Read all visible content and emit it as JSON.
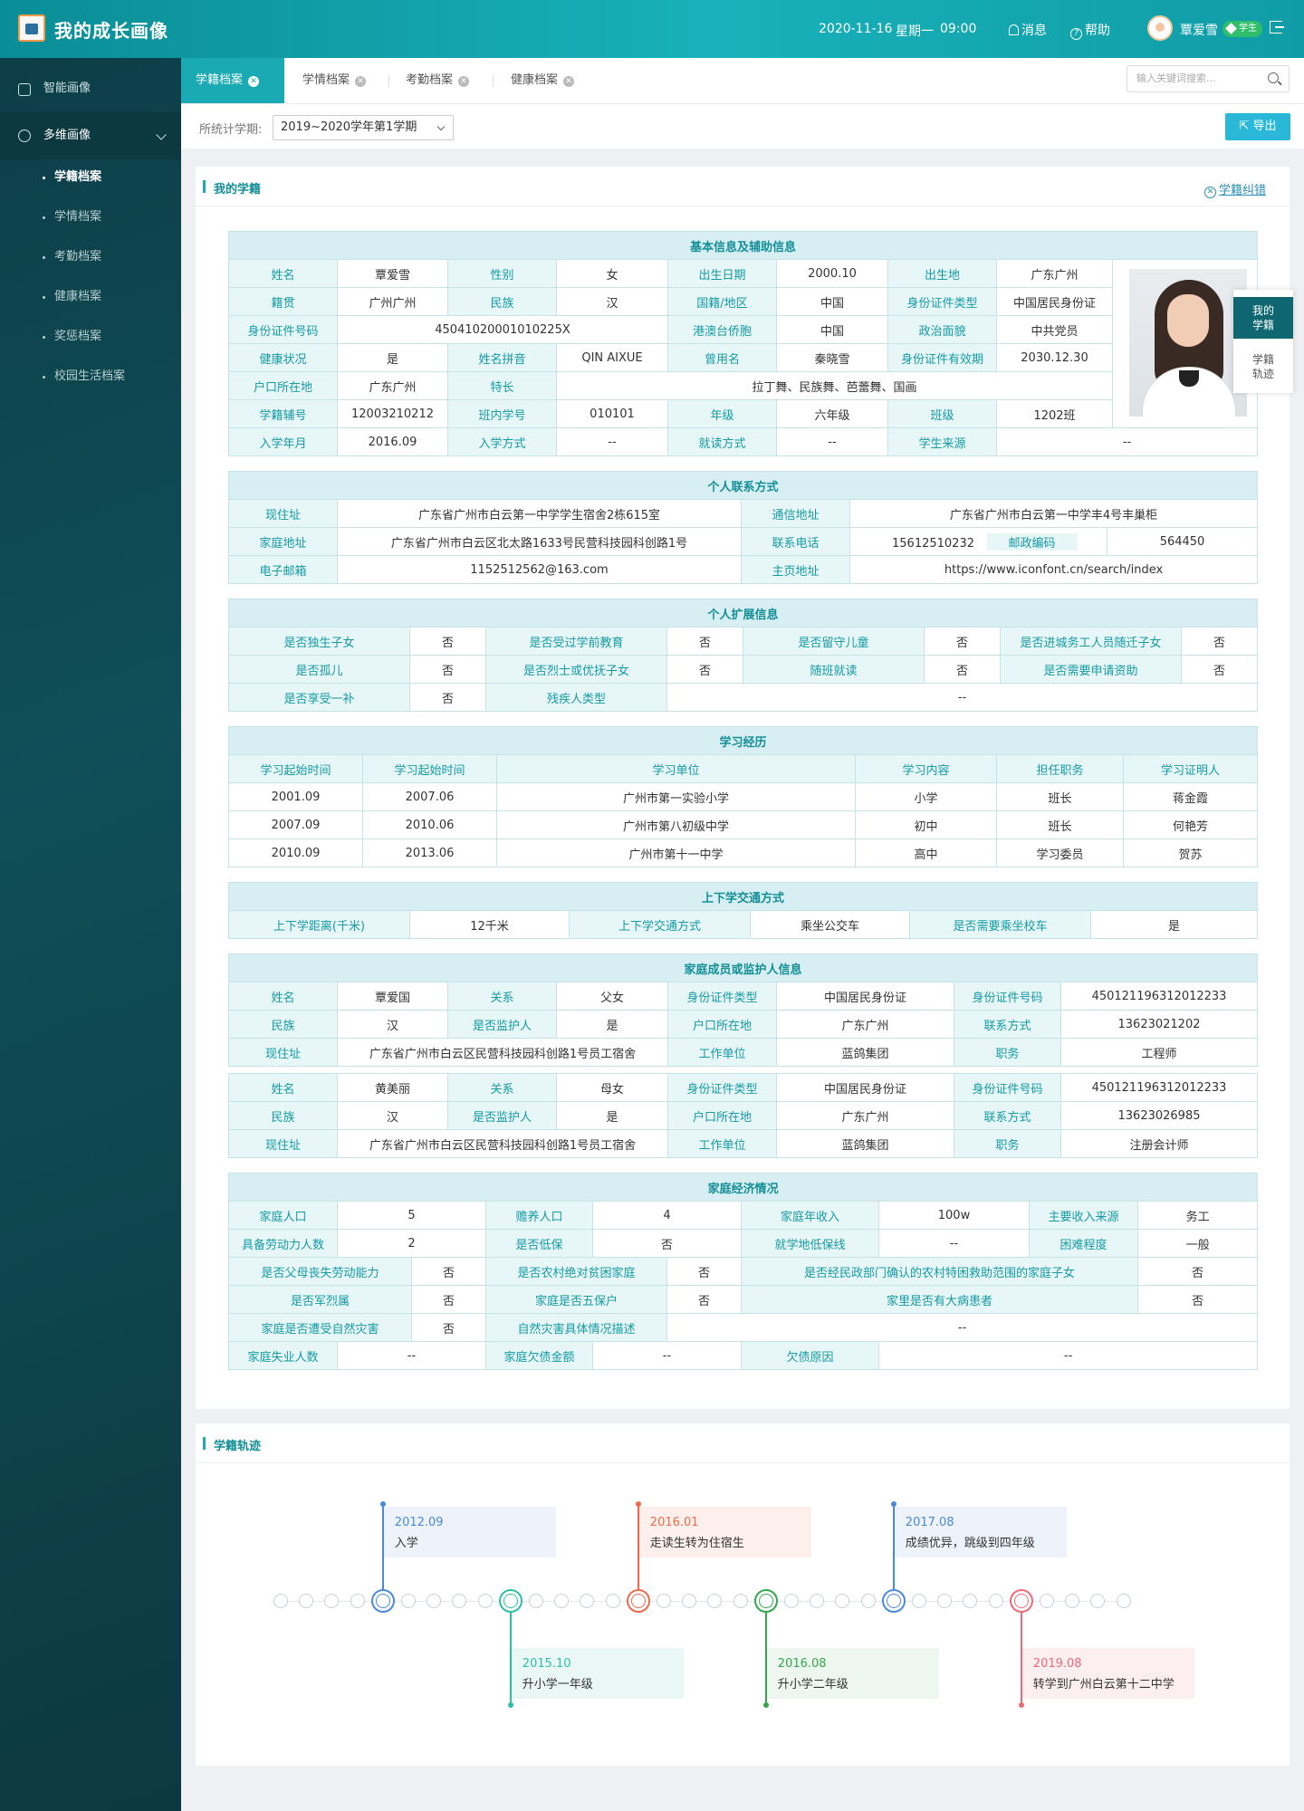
{
  "app": {
    "title": "我的成长画像"
  },
  "header": {
    "date": "2020-11-16",
    "weekday": "星期一",
    "time": "09:00",
    "messages": "消息",
    "help": "帮助",
    "user_name": "覃爱雪",
    "role": "学生"
  },
  "sidebar": {
    "items": [
      {
        "label": "智能画像"
      },
      {
        "label": "多维画像"
      }
    ],
    "sub_items": [
      {
        "label": "学籍档案"
      },
      {
        "label": "学情档案"
      },
      {
        "label": "考勤档案"
      },
      {
        "label": "健康档案"
      },
      {
        "label": "奖惩档案"
      },
      {
        "label": "校园生活档案"
      }
    ]
  },
  "tabs": [
    {
      "label": "学籍档案"
    },
    {
      "label": "学情档案"
    },
    {
      "label": "考勤档案"
    },
    {
      "label": "健康档案"
    }
  ],
  "search": {
    "placeholder": "输入关键词搜索..."
  },
  "filter": {
    "label": "所统计学期:",
    "value": "2019~2020学年第1学期",
    "export": "导出"
  },
  "record": {
    "title": "我的学籍",
    "correct": "学籍纠错",
    "basic": {
      "title": "基本信息及辅助信息",
      "rows": [
        [
          "姓名",
          "覃爱雪",
          "性别",
          "女",
          "出生日期",
          "2000.10",
          "出生地",
          "广东广州"
        ],
        [
          "籍贯",
          "广州广州",
          "民族",
          "汉",
          "国籍/地区",
          "中国",
          "身份证件类型",
          "中国居民身份证"
        ],
        [
          "身份证件号码",
          "45041020001010225X",
          "港澳台侨胞",
          "中国",
          "政治面貌",
          "中共党员"
        ],
        [
          "健康状况",
          "是",
          "姓名拼音",
          "QIN AIXUE",
          "曾用名",
          "秦晓雪",
          "身份证件有效期",
          "2030.12.30"
        ],
        [
          "户口所在地",
          "广东广州",
          "特长",
          "拉丁舞、民族舞、芭蕾舞、国画"
        ],
        [
          "学籍辅号",
          "12003210212",
          "班内学号",
          "010101",
          "年级",
          "六年级",
          "班级",
          "1202班"
        ],
        [
          "入学年月",
          "2016.09",
          "入学方式",
          "--",
          "就读方式",
          "--",
          "学生来源",
          "--"
        ]
      ]
    },
    "contact": {
      "title": "个人联系方式",
      "rows": [
        [
          "现住址",
          "广东省广州市白云第一中学学生宿舍2栋615室",
          "通信地址",
          "广东省广州市白云第一中学丰4号丰巢柜"
        ],
        [
          "家庭地址",
          "广东省广州市白云区北太路1633号民营科技园科创路1号",
          "联系电话",
          "15612510232",
          "邮政编码",
          "564450"
        ],
        [
          "电子邮箱",
          "1152512562@163.com",
          "主页地址",
          "https://www.iconfont.cn/search/index"
        ]
      ]
    },
    "extended": {
      "title": "个人扩展信息",
      "rows": [
        [
          "是否独生子女",
          "否",
          "是否受过学前教育",
          "否",
          "是否留守儿童",
          "否",
          "是否进城务工人员随迁子女",
          "否"
        ],
        [
          "是否孤儿",
          "否",
          "是否烈士或优抚子女",
          "否",
          "随班就读",
          "否",
          "是否需要申请资助",
          "否"
        ],
        [
          "是否享受一补",
          "否",
          "残疾人类型",
          "--"
        ]
      ]
    },
    "study": {
      "title": "学习经历",
      "headers": [
        "学习起始时间",
        "学习起始时间",
        "学习单位",
        "学习内容",
        "担任职务",
        "学习证明人"
      ],
      "rows": [
        [
          "2001.09",
          "2007.06",
          "广州市第一实验小学",
          "小学",
          "班长",
          "蒋金霞"
        ],
        [
          "2007.09",
          "2010.06",
          "广州市第八初级中学",
          "初中",
          "班长",
          "何艳芳"
        ],
        [
          "2010.09",
          "2013.06",
          "广州市第十一中学",
          "高中",
          "学习委员",
          "贺苏"
        ]
      ]
    },
    "transport": {
      "title": "上下学交通方式",
      "row": [
        "上下学距离(千米)",
        "12千米",
        "上下学交通方式",
        "乘坐公交车",
        "是否需要乘坐校车",
        "是"
      ]
    },
    "family": {
      "title": "家庭成员或监护人信息",
      "members": [
        [
          [
            "姓名",
            "覃爱国",
            "关系",
            "父女",
            "身份证件类型",
            "中国居民身份证",
            "身份证件号码",
            "450121196312012233"
          ],
          [
            "民族",
            "汉",
            "是否监护人",
            "是",
            "户口所在地",
            "广东广州",
            "联系方式",
            "13623021202"
          ],
          [
            "现住址",
            "广东省广州市白云区民营科技园科创路1号员工宿舍",
            "工作单位",
            "蓝鸽集团",
            "职务",
            "工程师"
          ]
        ],
        [
          [
            "姓名",
            "黄美丽",
            "关系",
            "母女",
            "身份证件类型",
            "中国居民身份证",
            "身份证件号码",
            "450121196312012233"
          ],
          [
            "民族",
            "汉",
            "是否监护人",
            "是",
            "户口所在地",
            "广东广州",
            "联系方式",
            "13623026985"
          ],
          [
            "现住址",
            "广东省广州市白云区民营科技园科创路1号员工宿舍",
            "工作单位",
            "蓝鸽集团",
            "职务",
            "注册会计师"
          ]
        ]
      ]
    },
    "economy": {
      "title": "家庭经济情况",
      "rows": [
        [
          "家庭人口",
          "5",
          "赡养人口",
          "4",
          "家庭年收入",
          "100w",
          "主要收入来源",
          "务工"
        ],
        [
          "具备劳动力人数",
          "2",
          "是否低保",
          "否",
          "就学地低保线",
          "--",
          "困难程度",
          "一般"
        ],
        [
          "是否父母丧失劳动能力",
          "否",
          "是否农村绝对贫困家庭",
          "否",
          "是否经民政部门确认的农村特困救助范围的家庭子女",
          "否"
        ],
        [
          "是否军烈属",
          "否",
          "家庭是否五保户",
          "否",
          "家里是否有大病患者",
          "否"
        ],
        [
          "家庭是否遭受自然灾害",
          "否",
          "自然灾害具体情况描述",
          "--"
        ],
        [
          "家庭失业人数",
          "--",
          "家庭欠债金额",
          "--",
          "欠债原因",
          "--"
        ]
      ]
    }
  },
  "float": {
    "a": [
      "我的",
      "学籍"
    ],
    "b": [
      "学籍",
      "轨迹"
    ]
  },
  "timeline": {
    "title": "学籍轨迹",
    "colors": {
      "blue": "#4a8ad8",
      "teal": "#2fbfa8",
      "orange": "#ee6a4a",
      "green": "#32a84a",
      "pink": "#ee6a78"
    },
    "events": [
      {
        "date": "2012.09",
        "text": "入学",
        "color": "blue",
        "side": "top"
      },
      {
        "date": "2015.10",
        "text": "升小学一年级",
        "color": "teal",
        "side": "bottom"
      },
      {
        "date": "2016.01",
        "text": "走读生转为住宿生",
        "color": "orange",
        "side": "top"
      },
      {
        "date": "2016.08",
        "text": "升小学二年级",
        "color": "green",
        "side": "bottom"
      },
      {
        "date": "2017.08",
        "text": "成绩优异，跳级到四年级",
        "color": "blue",
        "side": "top"
      },
      {
        "date": "2019.08",
        "text": "转学到广州白云第十二中学",
        "color": "pink",
        "side": "bottom"
      }
    ]
  }
}
